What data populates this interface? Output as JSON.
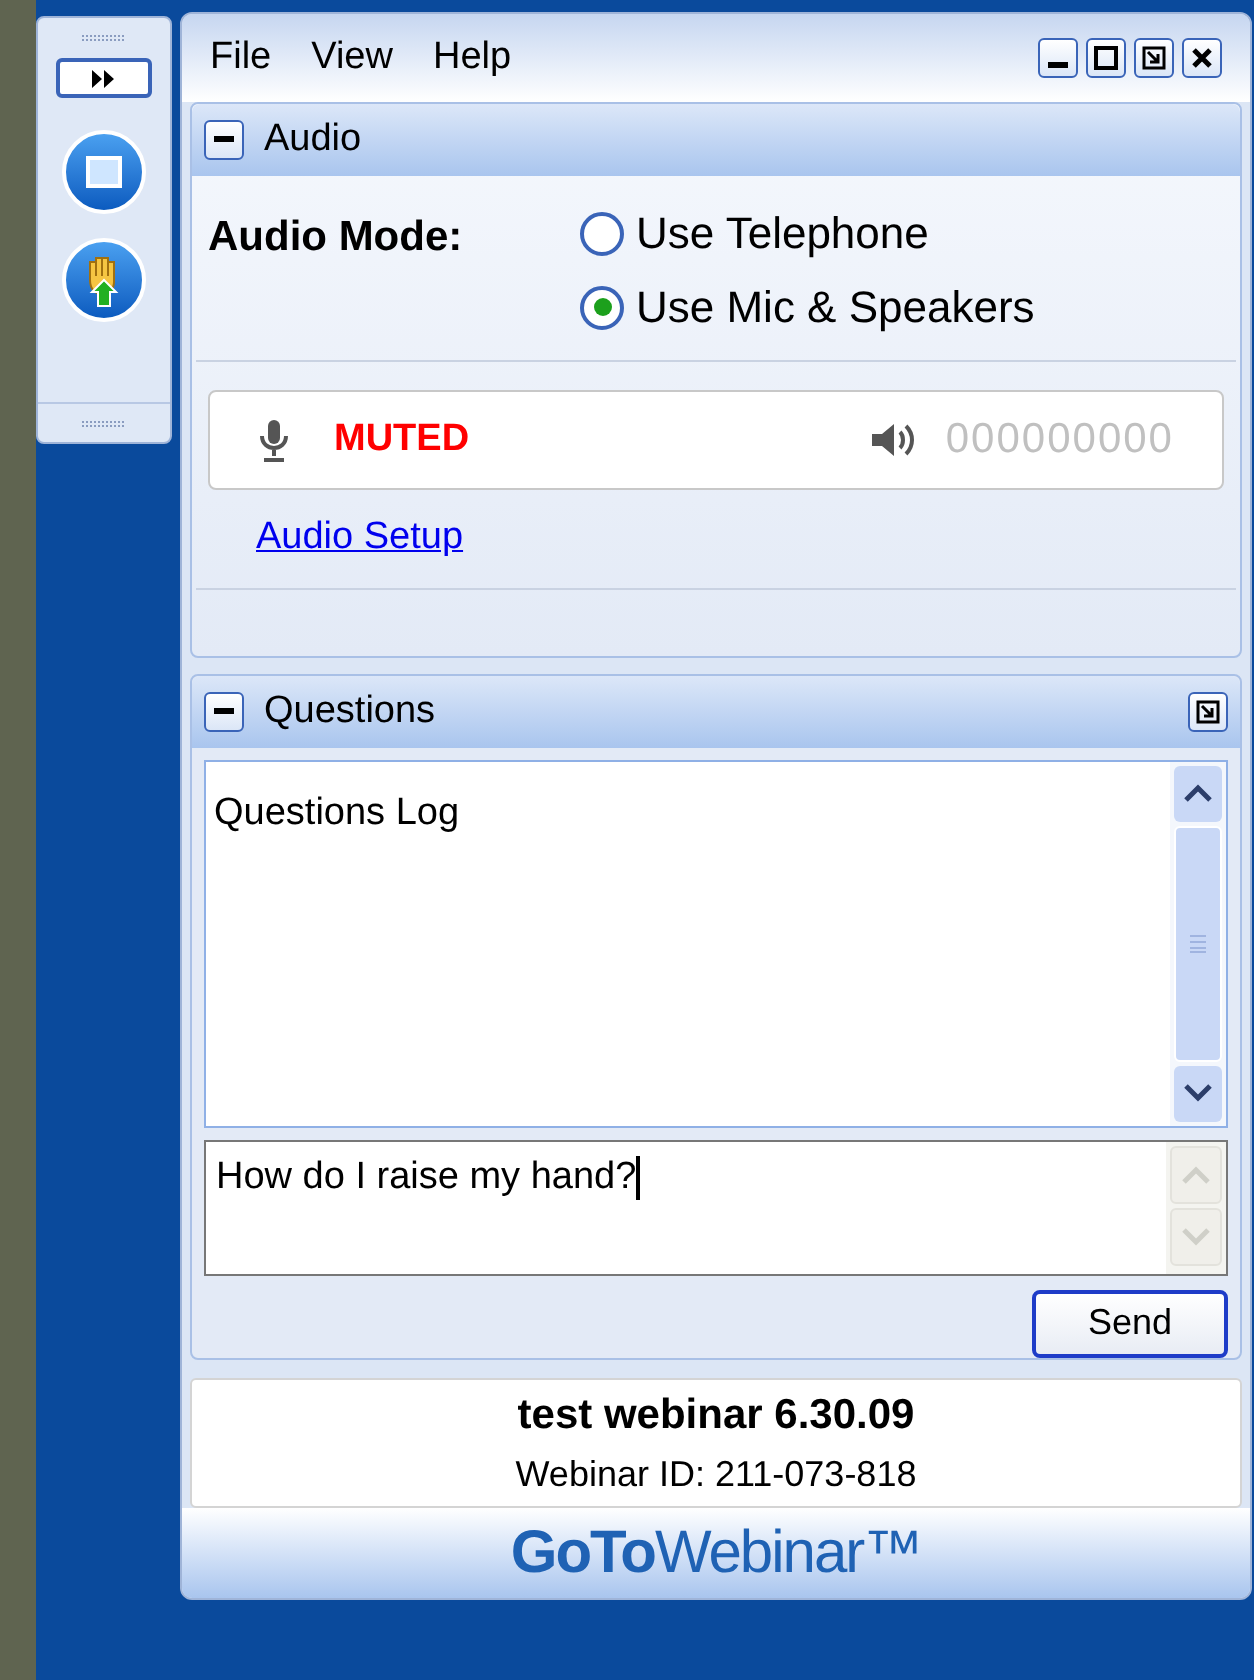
{
  "menu": [
    "File",
    "View",
    "Help"
  ],
  "audio": {
    "title": "Audio",
    "mode_label": "Audio Mode:",
    "options": [
      {
        "label": "Use Telephone",
        "selected": false
      },
      {
        "label": "Use Mic & Speakers",
        "selected": true
      }
    ],
    "mic_status": "MUTED",
    "speaker_level": "000000000",
    "setup_link": "Audio Setup"
  },
  "questions": {
    "title": "Questions",
    "log_title": "Questions Log",
    "input_value": "How do I raise my hand?",
    "send": "Send"
  },
  "info": {
    "title": "test webinar 6.30.09",
    "webinar_id": "Webinar ID: 211-073-818"
  },
  "logo": "**GoTo**Webinar™"
}
